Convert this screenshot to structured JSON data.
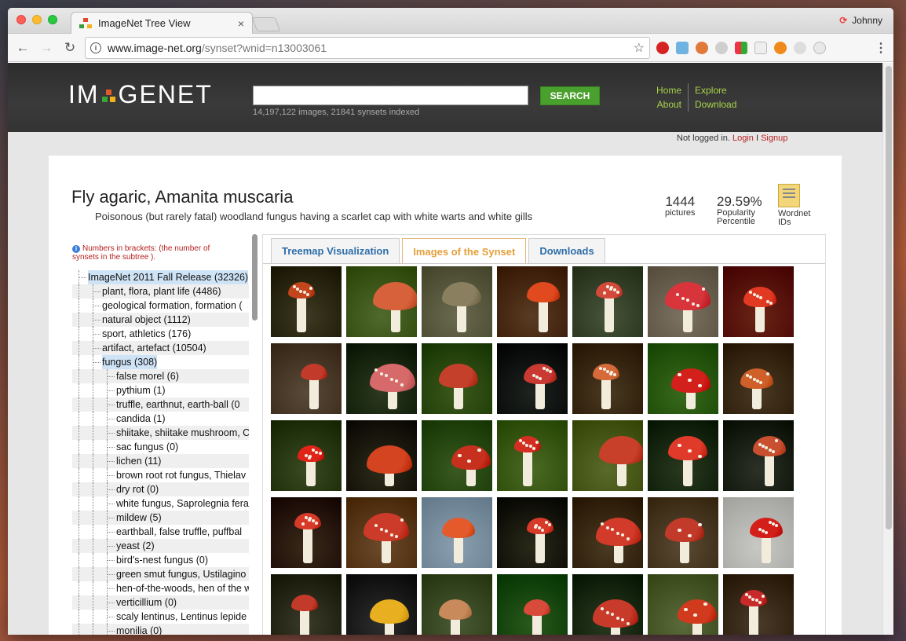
{
  "browser": {
    "tab_title": "ImageNet Tree View",
    "tab_close": "×",
    "user_name": "Johnny",
    "url_host": "www.image-net.org",
    "url_path": "/synset?wnid=n13003061",
    "back_glyph": "←",
    "forward_glyph": "→",
    "reload_glyph": "↻",
    "star_glyph": "☆",
    "menu_glyph": "⋮",
    "info_glyph": "i",
    "extensions": [
      "pinterest-icon",
      "gem-icon",
      "evernote-icon",
      "moon-icon",
      "office-icon",
      "window-icon",
      "orange-circle-icon",
      "gear-icon",
      "refresh-extension-icon"
    ]
  },
  "site": {
    "logo_left": "IM",
    "logo_right": "GENET",
    "search_placeholder": "",
    "search_button": "SEARCH",
    "stats": "14,197,122 images, 21841 synsets indexed",
    "nav": [
      {
        "label": "Home"
      },
      {
        "label": "Explore"
      },
      {
        "label": "About"
      },
      {
        "label": "Download"
      }
    ],
    "login_status": "Not logged in.",
    "login": "Login",
    "login_sep": "I",
    "signup": "Signup"
  },
  "synset": {
    "title": "Fly agaric, Amanita muscaria",
    "description": "Poisonous (but rarely fatal) woodland fungus having a scarlet cap with white warts and white gills",
    "pictures_count": "1444",
    "pictures_label": "pictures",
    "popularity_value": "29.59%",
    "popularity_label_1": "Popularity",
    "popularity_label_2": "Percentile",
    "wordnet_label_1": "Wordnet",
    "wordnet_label_2": "IDs"
  },
  "tree": {
    "note": "Numbers in brackets: (the number of synsets in the subtree ).",
    "info_glyph": "i",
    "items": [
      {
        "label": "ImageNet 2011 Fall Release (32326)",
        "depth": 0,
        "selected": true
      },
      {
        "label": "plant, flora, plant life (4486)",
        "depth": 1
      },
      {
        "label": "geological formation, formation (",
        "depth": 1
      },
      {
        "label": "natural object (1112)",
        "depth": 1
      },
      {
        "label": "sport, athletics (176)",
        "depth": 1
      },
      {
        "label": "artifact, artefact (10504)",
        "depth": 1
      },
      {
        "label": "fungus (308)",
        "depth": 1,
        "selected": true
      },
      {
        "label": "false morel (6)",
        "depth": 2
      },
      {
        "label": "pythium (1)",
        "depth": 2
      },
      {
        "label": "truffle, earthnut, earth-ball (0",
        "depth": 2
      },
      {
        "label": "candida (1)",
        "depth": 2
      },
      {
        "label": "shiitake, shiitake mushroom, C",
        "depth": 2
      },
      {
        "label": "sac fungus (0)",
        "depth": 2
      },
      {
        "label": "lichen (11)",
        "depth": 2
      },
      {
        "label": "brown root rot fungus, Thielav",
        "depth": 2
      },
      {
        "label": "dry rot (0)",
        "depth": 2
      },
      {
        "label": "white fungus, Saprolegnia fera",
        "depth": 2
      },
      {
        "label": "mildew (5)",
        "depth": 2
      },
      {
        "label": "earthball, false truffle, puffbal",
        "depth": 2
      },
      {
        "label": "yeast (2)",
        "depth": 2
      },
      {
        "label": "bird's-nest fungus (0)",
        "depth": 2
      },
      {
        "label": "green smut fungus, Ustilagino",
        "depth": 2
      },
      {
        "label": "hen-of-the-woods, hen of the w",
        "depth": 2
      },
      {
        "label": "verticillium (0)",
        "depth": 2
      },
      {
        "label": "scaly lentinus, Lentinus lepide",
        "depth": 2
      },
      {
        "label": "monilia (0)",
        "depth": 2
      }
    ]
  },
  "panel": {
    "tabs": [
      {
        "label": "Treemap Visualization",
        "active": false
      },
      {
        "label": "Images of the Synset",
        "active": true
      },
      {
        "label": "Downloads",
        "active": false
      }
    ]
  },
  "thumbnails": [
    {
      "bg": "#3d3a22",
      "cap": "#c2451c",
      "dots": true
    },
    {
      "bg": "#4f6a2c",
      "cap": "#d6613a",
      "dots": false
    },
    {
      "bg": "#6a6a50",
      "cap": "#8a8060",
      "dots": false
    },
    {
      "bg": "#5a3c24",
      "cap": "#e04a1e",
      "dots": false
    },
    {
      "bg": "#47533a",
      "cap": "#d44a3a",
      "dots": true
    },
    {
      "bg": "#7c7262",
      "cap": "#d8343c",
      "dots": true
    },
    {
      "bg": "#6a2416",
      "cap": "#e23a22",
      "dots": true
    },
    {
      "bg": "#5a4a3a",
      "cap": "#c23a2a",
      "dots": false
    },
    {
      "bg": "#2d3a20",
      "cap": "#d66a6a",
      "dots": true
    },
    {
      "bg": "#3c5a1c",
      "cap": "#c4402a",
      "dots": false
    },
    {
      "bg": "#1e2420",
      "cap": "#c83a32",
      "dots": true
    },
    {
      "bg": "#4a3a22",
      "cap": "#d66a3a",
      "dots": true
    },
    {
      "bg": "#3a6a1c",
      "cap": "#d4201a",
      "dots": true
    },
    {
      "bg": "#4a3a24",
      "cap": "#d0602a",
      "dots": true
    },
    {
      "bg": "#3a4a22",
      "cap": "#e02418",
      "dots": true
    },
    {
      "bg": "#2e2c1a",
      "cap": "#d44420",
      "dots": false
    },
    {
      "bg": "#3a5a22",
      "cap": "#c8301e",
      "dots": true
    },
    {
      "bg": "#4a6a24",
      "cap": "#d42e22",
      "dots": true
    },
    {
      "bg": "#5a6a2a",
      "cap": "#c8402a",
      "dots": false
    },
    {
      "bg": "#2a3a20",
      "cap": "#e03a2a",
      "dots": true
    },
    {
      "bg": "#2c3228",
      "cap": "#c85030",
      "dots": true
    },
    {
      "bg": "#3a2a1a",
      "cap": "#d83a2a",
      "dots": true
    },
    {
      "bg": "#6a4a2a",
      "cap": "#cc3a2a",
      "dots": true
    },
    {
      "bg": "#8aa0b0",
      "cap": "#e45a2a",
      "dots": false
    },
    {
      "bg": "#2a2a1a",
      "cap": "#d83a2a",
      "dots": true
    },
    {
      "bg": "#4a3a22",
      "cap": "#d23a2a",
      "dots": true
    },
    {
      "bg": "#5a4a34",
      "cap": "#c23a2a",
      "dots": true
    },
    {
      "bg": "#c8c8c4",
      "cap": "#d41e1a",
      "dots": true
    },
    {
      "bg": "#3a3a2a",
      "cap": "#c23a2a",
      "dots": false
    },
    {
      "bg": "#2e2e2e",
      "cap": "#e8b020",
      "dots": false
    },
    {
      "bg": "#4a5a34",
      "cap": "#c88a5a",
      "dots": false
    },
    {
      "bg": "#2a5a1c",
      "cap": "#d84a3a",
      "dots": false
    },
    {
      "bg": "#2a3a20",
      "cap": "#c83a2a",
      "dots": true
    },
    {
      "bg": "#5a6a3a",
      "cap": "#d23a1e",
      "dots": true
    },
    {
      "bg": "#4a3a2a",
      "cap": "#c82a2a",
      "dots": true
    }
  ]
}
